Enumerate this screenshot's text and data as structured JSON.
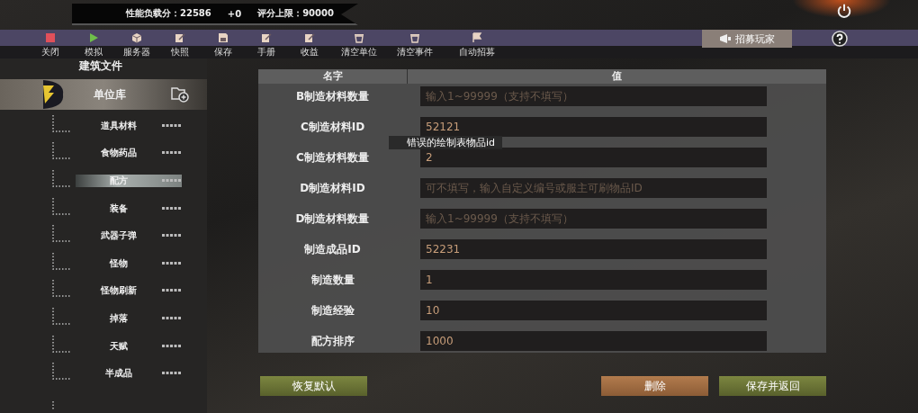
{
  "score_bar": {
    "load_label": "性能负载分：22586",
    "delta": "+0",
    "limit_label": "评分上限：90000"
  },
  "toolbar": [
    {
      "label": "关闭",
      "kind": "stop"
    },
    {
      "label": "模拟",
      "kind": "play"
    },
    {
      "label": "服务器",
      "kind": "box"
    },
    {
      "label": "快照",
      "kind": "edit"
    },
    {
      "label": "保存",
      "kind": "save"
    },
    {
      "label": "手册",
      "kind": "edit"
    },
    {
      "label": "收益",
      "kind": "edit"
    },
    {
      "label": "清空单位",
      "kind": "trash"
    },
    {
      "label": "清空事件",
      "kind": "trash"
    },
    {
      "label": "自动招募",
      "kind": "flag"
    }
  ],
  "recruit_tab": {
    "label": "招募玩家"
  },
  "sidebar": {
    "title": "建筑文件",
    "root": {
      "label": "单位库",
      "children": [
        {
          "label": "道具材料",
          "selected": false
        },
        {
          "label": "食物药品",
          "selected": false
        },
        {
          "label": "配方",
          "selected": true
        },
        {
          "label": "装备",
          "selected": false
        },
        {
          "label": "武器子弹",
          "selected": false
        },
        {
          "label": "怪物",
          "selected": false
        },
        {
          "label": "怪物刷新",
          "selected": false
        },
        {
          "label": "掉落",
          "selected": false
        },
        {
          "label": "天赋",
          "selected": false
        },
        {
          "label": "半成品",
          "selected": false
        }
      ]
    }
  },
  "table": {
    "columns": [
      "名字",
      "值"
    ],
    "rows": [
      {
        "name": "B制造材料数量",
        "placeholder": "输入1~99999（支持不填写）"
      },
      {
        "name": "C制造材料ID",
        "value": "52121"
      },
      {
        "name": "C制造材料数量",
        "value": "2"
      },
      {
        "name": "D制造材料ID",
        "placeholder": "可不填写，输入自定义编号或服主可刷物品ID"
      },
      {
        "name": "D制造材料数量",
        "placeholder": "输入1~99999（支持不填写）"
      },
      {
        "name": "制造成品ID",
        "value": "52231"
      },
      {
        "name": "制造数量",
        "value": "1"
      },
      {
        "name": "制造经验",
        "value": "10"
      },
      {
        "name": "配方排序",
        "value": "1000"
      }
    ]
  },
  "tooltip": "错误的绘制表物品id",
  "buttons": [
    {
      "label": "恢复默认",
      "kind": "neutral"
    },
    {
      "label": "删除",
      "kind": "danger"
    },
    {
      "label": "保存并返回",
      "kind": "confirm"
    }
  ]
}
